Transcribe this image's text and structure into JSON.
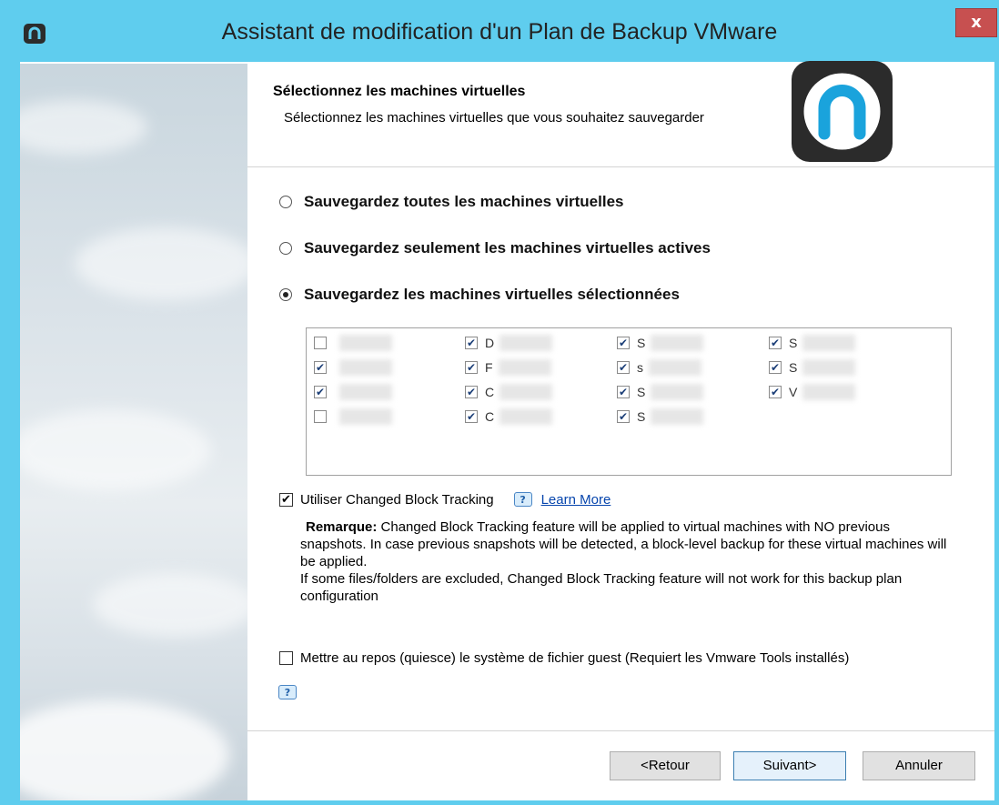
{
  "window": {
    "title": "Assistant de modification d'un Plan de Backup VMware",
    "close_label": "x"
  },
  "header": {
    "title": "Sélectionnez les machines virtuelles",
    "subtitle": "Sélectionnez les machines virtuelles que vous souhaitez sauvegarder"
  },
  "options": [
    {
      "label": "Sauvegardez  toutes les machines virtuelles",
      "selected": false
    },
    {
      "label": "Sauvegardez seulement les machines virtuelles actives",
      "selected": false
    },
    {
      "label": "Sauvegardez  les machines virtuelles sélectionnées",
      "selected": true
    }
  ],
  "vms": {
    "col1": [
      {
        "label": "",
        "checked": false
      },
      {
        "label": "",
        "checked": true
      },
      {
        "label": "",
        "checked": true
      },
      {
        "label": "",
        "checked": false
      }
    ],
    "col2": [
      {
        "label": "D",
        "checked": true
      },
      {
        "label": "F",
        "checked": true
      },
      {
        "label": "C",
        "checked": true
      },
      {
        "label": "C",
        "checked": true
      }
    ],
    "col3": [
      {
        "label": "S",
        "checked": true
      },
      {
        "label": "s",
        "checked": true
      },
      {
        "label": "S",
        "checked": true
      },
      {
        "label": "S",
        "checked": true
      }
    ],
    "col4": [
      {
        "label": "S",
        "checked": true
      },
      {
        "label": "S",
        "checked": true
      },
      {
        "label": "V",
        "checked": true
      }
    ]
  },
  "cbt": {
    "label": "Utiliser Changed Block Tracking",
    "checked": true,
    "learn_more": "Learn More",
    "help_glyph": "?"
  },
  "note": {
    "prefix": "Remarque:",
    "line1": "Changed Block Tracking feature will be applied to virtual machines with NO previous snapshots. In case previous snapshots will be detected, a block-level backup for these virtual machines will be applied.",
    "line2": "If some files/folders are excluded, Changed Block Tracking feature will not work for this backup plan configuration"
  },
  "quiesce": {
    "label": "Mettre au repos (quiesce) le système de fichier guest (Requiert les Vmware Tools installés)",
    "checked": false
  },
  "buttons": {
    "back": "<Retour",
    "next": "Suivant>",
    "cancel": "Annuler"
  },
  "colors": {
    "titlebar": "#5fcdee",
    "close": "#c75050",
    "logo_bg": "#2b2b2b",
    "logo_arc": "#1aa3dc"
  }
}
